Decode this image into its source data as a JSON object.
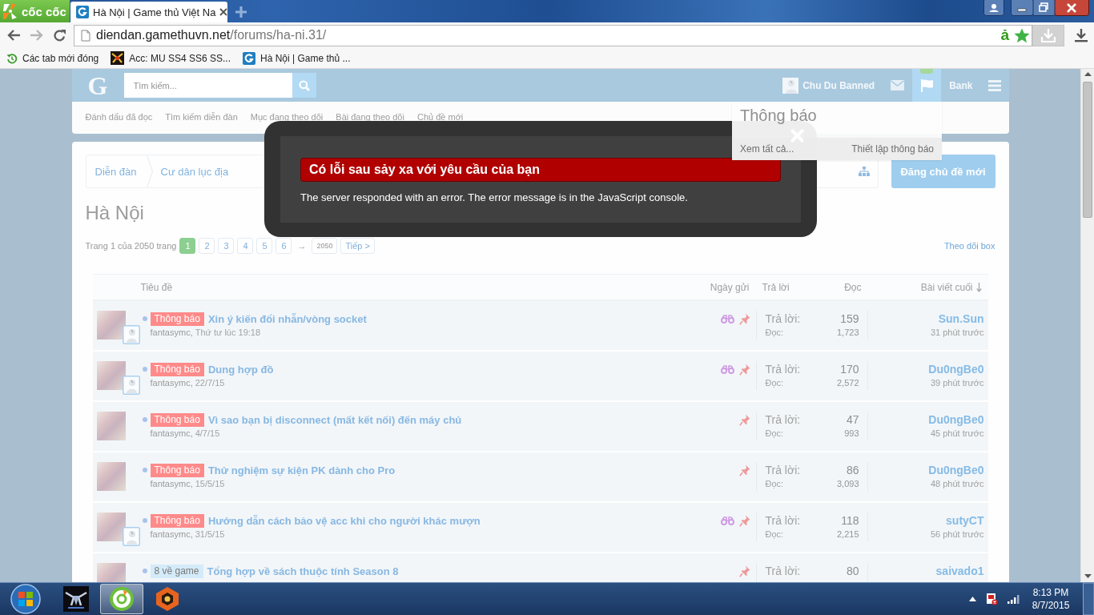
{
  "browser": {
    "logo": "cốc cốc",
    "tabs": [
      {
        "title": "Hà Nội | Game thủ Việt Na",
        "selected": true
      }
    ],
    "address": {
      "host": "diendan.gamethuvn.net",
      "path": "/forums/ha-ni.31/"
    },
    "input_mode": "ả",
    "bookmarks": [
      {
        "kind": "history",
        "label": "Các tab mới đóng"
      },
      {
        "kind": "game",
        "label": "Acc: MU SS4 SS6 SS..."
      },
      {
        "kind": "site",
        "label": "Hà Nội | Game thủ ..."
      }
    ]
  },
  "forum": {
    "header": {
      "logo": "G",
      "search": {
        "placeholder": "Tìm kiếm..."
      },
      "user": "Chu Du Banned",
      "alerts_open": true,
      "bank": "Bank"
    },
    "subnav": [
      "Đánh dấu đã đọc",
      "Tìm kiếm diễn đàn",
      "Mục đang theo dõi",
      "Bài đang theo dõi",
      "Chủ đề mới"
    ],
    "alerts_menu": {
      "title": "Thông báo",
      "view_all": "Xem tất cả...",
      "settings": "Thiết lập thông báo"
    },
    "breadcrumb": [
      "Diễn đàn",
      "Cư dân lục địa"
    ],
    "new_thread_button": "Đăng chủ đề mới",
    "title": "Hà Nội",
    "pagination": {
      "summary": "Trang 1 của 2050 trang",
      "pages": [
        {
          "label": "1",
          "selected": true
        },
        {
          "label": "2",
          "selected": false
        },
        {
          "label": "3",
          "selected": false
        },
        {
          "label": "4",
          "selected": false
        },
        {
          "label": "5",
          "selected": false
        },
        {
          "label": "6",
          "selected": false
        }
      ],
      "skip": "→",
      "last": "2050",
      "next": "Tiếp >"
    },
    "watch_link": "Theo dõi box",
    "table": {
      "columns": [
        {
          "label": "Tiêu đề",
          "sorted": false
        },
        {
          "label": "Ngày gửi",
          "sorted": false
        },
        {
          "label": "Trả lời",
          "sorted": false
        },
        {
          "label": "Đọc",
          "sorted": false
        },
        {
          "label": "Bài viết cuối",
          "sorted": true
        }
      ],
      "rows": [
        {
          "small_avatar": true,
          "prefix": {
            "label": "Thông báo",
            "color": "#ff8a8a"
          },
          "title": "Xin ý kiến đổi nhẫn/vòng socket",
          "author": "fantasymc,",
          "date": "Thứ tư lúc 19:18",
          "watched": true,
          "sticky": true,
          "replies_label": "Trả lời:",
          "replies": "159",
          "views_label": "Đọc:",
          "views": "1,723",
          "last_poster": "Sun.Sun",
          "last_time": "31 phút trước"
        },
        {
          "small_avatar": true,
          "prefix": {
            "label": "Thông báo",
            "color": "#ff8a8a"
          },
          "title": "Dung hợp đồ",
          "author": "fantasymc,",
          "date": "22/7/15",
          "watched": true,
          "sticky": true,
          "replies_label": "Trả lời:",
          "replies": "170",
          "views_label": "Đọc:",
          "views": "2,572",
          "last_poster": "Du0ngBe0",
          "last_time": "39 phút trước"
        },
        {
          "small_avatar": false,
          "prefix": {
            "label": "Thông báo",
            "color": "#ff8a8a"
          },
          "title": "Vì sao bạn bị disconnect (mất kết nối) đến máy chủ",
          "author": "fantasymc,",
          "date": "4/7/15",
          "watched": false,
          "sticky": true,
          "replies_label": "Trả lời:",
          "replies": "47",
          "views_label": "Đọc:",
          "views": "993",
          "last_poster": "Du0ngBe0",
          "last_time": "45 phút trước"
        },
        {
          "small_avatar": false,
          "prefix": {
            "label": "Thông báo",
            "color": "#ff8a8a"
          },
          "title": "Thử nghiệm sự kiện PK dành cho Pro",
          "author": "fantasymc,",
          "date": "15/5/15",
          "watched": false,
          "sticky": true,
          "replies_label": "Trả lời:",
          "replies": "86",
          "views_label": "Đọc:",
          "views": "3,093",
          "last_poster": "Du0ngBe0",
          "last_time": "48 phút trước"
        },
        {
          "small_avatar": true,
          "prefix": {
            "label": "Thông báo",
            "color": "#ff8a8a"
          },
          "title": "Hướng dẫn cách bảo vệ acc khi cho người khác mượn",
          "author": "fantasymc,",
          "date": "31/5/15",
          "watched": true,
          "sticky": true,
          "replies_label": "Trả lời:",
          "replies": "118",
          "views_label": "Đọc:",
          "views": "2,215",
          "last_poster": "sutyCT",
          "last_time": "56 phút trước"
        },
        {
          "small_avatar": false,
          "prefix": {
            "label": "8 về game",
            "color": "#d4ebf9"
          },
          "title": "Tổng hợp về sách thuộc tính Season 8",
          "watched": false,
          "sticky": true,
          "replies_label": "Trả lời:",
          "replies": "80",
          "last_poster": "saivado1"
        }
      ]
    }
  },
  "error_dialog": {
    "title": "Có lỗi sau sảy xa với yêu cầu của bạn",
    "message": "The server responded with an error. The error message is in the JavaScript console."
  },
  "taskbar": {
    "apps": [
      {
        "kind": "emblem",
        "selected": false
      },
      {
        "kind": "browser",
        "selected": true
      },
      {
        "kind": "hexagon",
        "selected": false
      }
    ],
    "time": "8:13 PM",
    "date": "8/7/2015"
  }
}
